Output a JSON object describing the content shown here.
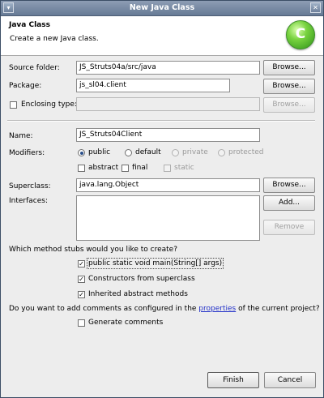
{
  "window": {
    "title": "New Java Class"
  },
  "banner": {
    "title": "Java Class",
    "description": "Create a new Java class.",
    "logo_glyph": "C"
  },
  "source_folder": {
    "label": "Source folder:",
    "value": "JS_Struts04a/src/java",
    "browse_label": "Browse..."
  },
  "package": {
    "label": "Package:",
    "value": "js_sl04.client",
    "browse_label": "Browse..."
  },
  "enclosing_type": {
    "label": "Enclosing type:",
    "value": "",
    "checked": false,
    "browse_label": "Browse..."
  },
  "name": {
    "label": "Name:",
    "value": "JS_Struts04Client"
  },
  "modifiers": {
    "label": "Modifiers:",
    "public": "public",
    "default": "default",
    "private": "private",
    "protected": "protected",
    "abstract": "abstract",
    "final": "final",
    "static": "static"
  },
  "superclass": {
    "label": "Superclass:",
    "value": "java.lang.Object",
    "browse_label": "Browse..."
  },
  "interfaces": {
    "label": "Interfaces:",
    "add_label": "Add...",
    "remove_label": "Remove",
    "items": []
  },
  "stubs": {
    "question": "Which method stubs would you like to create?",
    "main": "public static void main(String[] args)",
    "constructors": "Constructors from superclass",
    "inherited": "Inherited abstract methods"
  },
  "comments": {
    "question_before": "Do you want to add comments as configured in the ",
    "link": "properties",
    "question_after": " of the current project?",
    "generate": "Generate comments"
  },
  "footer": {
    "finish_label": "Finish",
    "cancel_label": "Cancel"
  }
}
